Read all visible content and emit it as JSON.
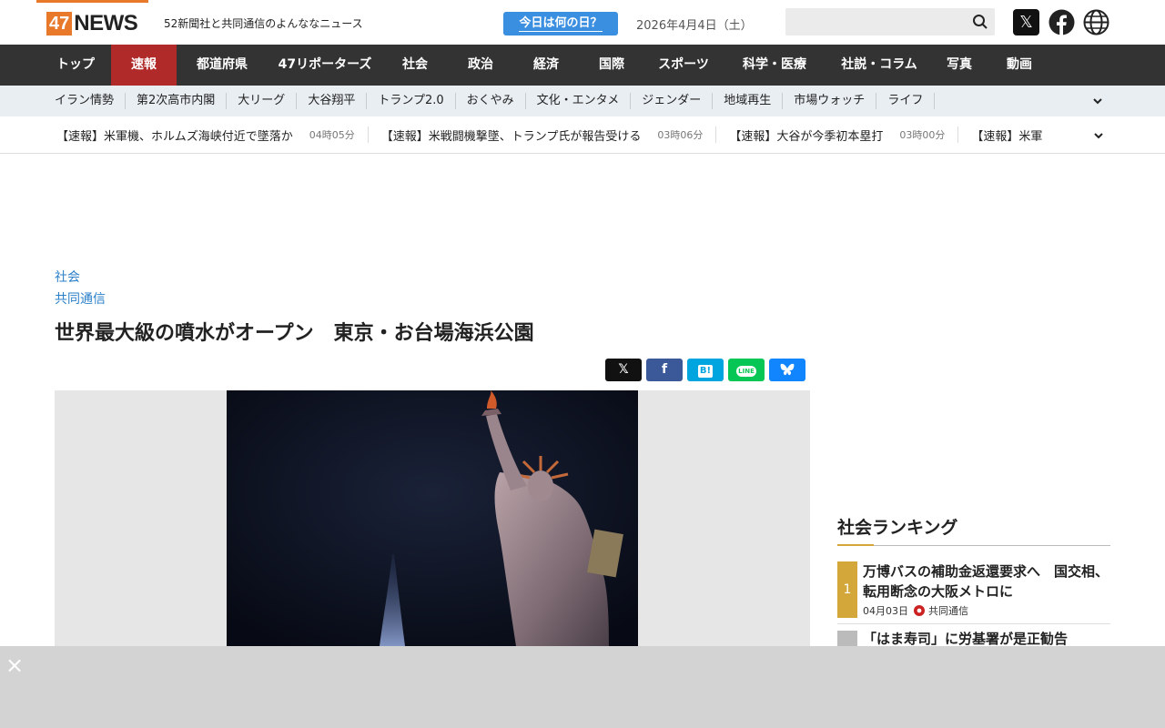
{
  "header": {
    "logo_num": "47",
    "logo_text": "NEWS",
    "tagline": "52新聞社と共同通信のよんななニュース",
    "today_button": "今日は何の日？",
    "date": "2026年4月4日（土）",
    "search_placeholder": "",
    "social_icons": [
      "x-icon",
      "facebook-icon",
      "globe-icon"
    ]
  },
  "main_nav": {
    "items": [
      {
        "label": "トップ"
      },
      {
        "label": "速報",
        "active": true
      },
      {
        "label": "都道府県"
      },
      {
        "label": "47リポーターズ"
      },
      {
        "label": "社会"
      },
      {
        "label": "政治"
      },
      {
        "label": "経済"
      },
      {
        "label": "国際"
      },
      {
        "label": "スポーツ"
      },
      {
        "label": "科学・医療"
      },
      {
        "label": "社説・コラム"
      },
      {
        "label": "写真"
      },
      {
        "label": "動画"
      }
    ]
  },
  "sub_nav": {
    "items": [
      "イラン情勢",
      "第2次高市内閣",
      "大リーグ",
      "大谷翔平",
      "トランプ2.0",
      "おくやみ",
      "文化・エンタメ",
      "ジェンダー",
      "地域再生",
      "市場ウォッチ",
      "ライフ"
    ]
  },
  "ticker": {
    "items": [
      {
        "title": "【速報】米軍機、ホルムズ海峡付近で墜落か",
        "time": "04時05分"
      },
      {
        "title": "【速報】米戦闘機撃墜、トランプ氏が報告受ける",
        "time": "03時06分"
      },
      {
        "title": "【速報】大谷が今季初本塁打",
        "time": "03時00分"
      },
      {
        "title": "【速報】米軍",
        "time": ""
      }
    ]
  },
  "article": {
    "category": "社会",
    "source": "共同通信",
    "headline": "世界最大級の噴水がオープン　東京・お台場海浜公園",
    "share_buttons": [
      {
        "name": "x",
        "label": "𝕏",
        "color": "#111111"
      },
      {
        "name": "facebook",
        "label": "f",
        "color": "#3b5998"
      },
      {
        "name": "hatena",
        "label": "B!",
        "color": "#00a4de"
      },
      {
        "name": "line",
        "label": "LINE",
        "color": "#06c755"
      },
      {
        "name": "bluesky",
        "label": "🦋",
        "color": "#1185fe"
      }
    ]
  },
  "ranking": {
    "title": "社会ランキング",
    "items": [
      {
        "rank": "1",
        "text": "万博バスの補助金返還要求へ　国交相、転用断念の大阪メトロに",
        "date": "04月03日",
        "source": "共同通信"
      },
      {
        "rank": "",
        "text": "「はま寿司」に労基署が是正勧告",
        "date": "",
        "source": ""
      }
    ]
  },
  "ad": {
    "close_label": "×"
  },
  "colors": {
    "brand_orange": "#e8792a",
    "nav_dark": "#333333",
    "nav_active": "#b02a2a",
    "link_blue": "#2a7fc9",
    "rank_gold": "#d4a73a"
  }
}
